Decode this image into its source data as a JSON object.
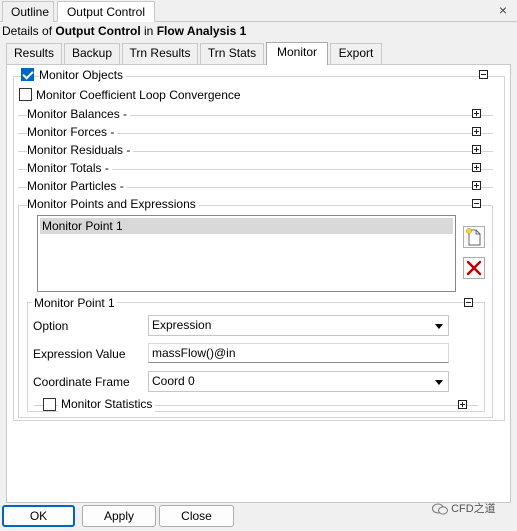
{
  "top_tabs": {
    "outline": "Outline",
    "active": "Output Control"
  },
  "close_glyph": "×",
  "details": {
    "prefix": "Details of ",
    "object": "Output Control",
    "middle": " in ",
    "context": "Flow Analysis 1"
  },
  "sub_tabs": [
    "Results",
    "Backup",
    "Trn Results",
    "Trn Stats",
    "Monitor",
    "Export"
  ],
  "active_sub_tab": "Monitor",
  "monitor_objects": {
    "label": "Monitor Objects",
    "checked": true
  },
  "coeff_loop": {
    "label": "Monitor Coefficient Loop Convergence",
    "checked": false
  },
  "sections": [
    "Monitor Balances -",
    "Monitor Forces -",
    "Monitor Residuals -",
    "Monitor Totals -",
    "Monitor Particles -"
  ],
  "points_section": {
    "label": "Monitor Points and Expressions",
    "items": [
      "Monitor Point 1"
    ]
  },
  "point_detail": {
    "title": "Monitor Point 1",
    "option_label": "Option",
    "option_value": "Expression",
    "expr_label": "Expression Value",
    "expr_value": "massFlow()@in",
    "frame_label": "Coordinate Frame",
    "frame_value": "Coord 0",
    "stats_label": "Monitor Statistics",
    "stats_checked": false
  },
  "buttons": {
    "ok": "OK",
    "apply": "Apply",
    "close": "Close"
  },
  "watermark": "CFD之道",
  "colors": {
    "accent": "#0067c0",
    "delete": "#c00000"
  }
}
